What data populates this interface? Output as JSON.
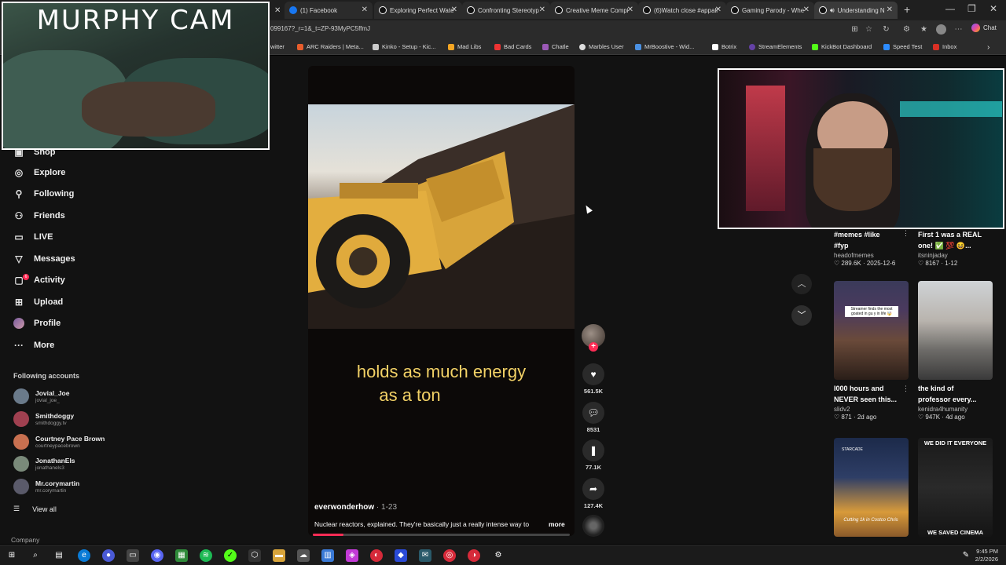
{
  "browser": {
    "tabs": [
      {
        "label": "(1) Facebook",
        "color": "#1877f2"
      },
      {
        "label": "Exploring Perfect Wate",
        "color": "#fff"
      },
      {
        "label": "Confronting Stereotyp",
        "color": "#fff"
      },
      {
        "label": "Creative Meme Compi",
        "color": "#fff"
      },
      {
        "label": "(6)Watch close #appali",
        "color": "#fff"
      },
      {
        "label": "Gaming Parody - Whe",
        "color": "#fff"
      },
      {
        "label": "Understanding N",
        "color": "#fff"
      }
    ],
    "url": "099167?_r=1&_t=ZP-93MyPC5ffmJ",
    "chat_label": "Chat",
    "bookmarks": [
      {
        "label": "witter",
        "color": "#1d9bf0"
      },
      {
        "label": "ARC Raiders | Meta...",
        "color": "#e85d2c"
      },
      {
        "label": "Kinko - Setup - Kic...",
        "color": "#ccc"
      },
      {
        "label": "Mad Libs",
        "color": "#f5a623"
      },
      {
        "label": "Bad Cards",
        "color": "#e33"
      },
      {
        "label": "Chatle",
        "color": "#9b59b6"
      },
      {
        "label": "Marbles User",
        "color": "#ddd"
      },
      {
        "label": "MrBoostive - Wid...",
        "color": "#4a90e2"
      },
      {
        "label": "Botrix",
        "color": "#fff"
      },
      {
        "label": "StreamElements",
        "color": "#6441a5"
      },
      {
        "label": "KickBot Dashboard",
        "color": "#53fc18"
      },
      {
        "label": "Speed Test",
        "color": "#2d8cff"
      },
      {
        "label": "Inbox",
        "color": "#d93025"
      }
    ]
  },
  "overlay": {
    "murphy_cam_title": "MURPHY CAM"
  },
  "nav": {
    "partial_item": "Shop",
    "items": [
      {
        "label": "Explore",
        "icon": "compass-icon",
        "glyph": "◎"
      },
      {
        "label": "Following",
        "icon": "person-plus-icon",
        "glyph": "⚲"
      },
      {
        "label": "Friends",
        "icon": "friends-icon",
        "glyph": "⚇"
      },
      {
        "label": "LIVE",
        "icon": "live-icon",
        "glyph": "▭"
      },
      {
        "label": "Messages",
        "icon": "messages-icon",
        "glyph": "▽"
      },
      {
        "label": "Activity",
        "icon": "activity-icon",
        "glyph": "▢"
      },
      {
        "label": "Upload",
        "icon": "upload-icon",
        "glyph": "⊞"
      },
      {
        "label": "Profile",
        "icon": "profile-icon",
        "glyph": "●"
      },
      {
        "label": "More",
        "icon": "more-icon",
        "glyph": "···"
      }
    ],
    "activity_badge": "6",
    "following_heading": "Following accounts",
    "accounts": [
      {
        "name": "Jovial_Joe",
        "handle": "jovial_joe_",
        "color": "#6a7a8a"
      },
      {
        "name": "Smithdoggy",
        "handle": "smithdoggy.tv",
        "color": "#a04050"
      },
      {
        "name": "Courtney Pace Brown",
        "handle": "courtneypacebrown",
        "color": "#c87050"
      },
      {
        "name": "JonathanEls",
        "handle": "jonathanels3",
        "color": "#7a8a7a"
      },
      {
        "name": "Mr.corymartin",
        "handle": "mr.corymartin",
        "color": "#5a5a6a"
      }
    ],
    "view_all": "View all",
    "company": "Company"
  },
  "video": {
    "caption_line1": "holds as much energy",
    "caption_line2": "as a ton",
    "author": "everwonderhow",
    "date": " · 1-23",
    "description": "Nuclear reactors, explained. They're basically just a really intense way to",
    "more": "more",
    "progress": 0.12
  },
  "actions": {
    "likes": "561.5K",
    "comments": "8531",
    "saves": "77.1K",
    "shares": "127.4K"
  },
  "grid": [
    {
      "title1": "#memes #like",
      "title2": "#fyp",
      "user": "headofmemes",
      "meta": "♡ 289.6K · 2025-12-6"
    },
    {
      "title1": "First 1 was a REAL",
      "title2": "one! ✅ 💯 😆...",
      "user": "itsninjaday",
      "meta": "♡ 8167 · 1-12"
    },
    {
      "title1": "I000 hours and",
      "title2": "NEVER seen this...",
      "user": "slidv2",
      "meta": "♡ 871 · 2d ago",
      "overlay": "Streamer finds the most goated in gu y in life 🤯"
    },
    {
      "title1": "the kind of",
      "title2": "professor every...",
      "user": "kenidra4humanity",
      "meta": "♡ 947K · 4d ago"
    },
    {
      "thumb_text": "Cutting 1k in Costco Chris",
      "brand": "STARCADE"
    },
    {
      "top_text": "WE DID IT EVERYONE",
      "bottom_text": "WE SAVED CINEMA"
    }
  ],
  "taskbar": {
    "time": "9:45 PM",
    "date": "2/2/2026"
  }
}
